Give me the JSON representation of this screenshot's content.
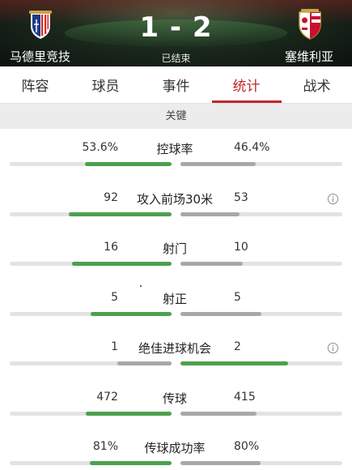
{
  "header": {
    "home_team": "马德里竞技",
    "away_team": "塞维利亚",
    "score": "1 - 2",
    "status": "已结束",
    "home_crest_icon": "atletico-crest-icon",
    "away_crest_icon": "sevilla-crest-icon"
  },
  "tabs": [
    {
      "label": "阵容"
    },
    {
      "label": "球员"
    },
    {
      "label": "事件"
    },
    {
      "label": "统计",
      "active": true
    },
    {
      "label": "战术"
    }
  ],
  "section": {
    "title": "关键"
  },
  "colors": {
    "accent": "#c0262c",
    "bar_win": "#4ca14e",
    "bar_lose": "#a8a8a8",
    "track": "#e3e3e3"
  },
  "stats": [
    {
      "label": "控球率",
      "home": "53.6%",
      "away": "46.4%",
      "home_fraction": 0.536,
      "away_fraction": 0.464,
      "info": false
    },
    {
      "label": "攻入前场30米",
      "home": "92",
      "away": "53",
      "home_fraction": 0.634,
      "away_fraction": 0.366,
      "info": true
    },
    {
      "label": "射门",
      "home": "16",
      "away": "10",
      "home_fraction": 0.615,
      "away_fraction": 0.385,
      "info": false
    },
    {
      "label": "射正",
      "home": "5",
      "away": "5",
      "home_fraction": 0.5,
      "away_fraction": 0.5,
      "info": false
    },
    {
      "label": "绝佳进球机会",
      "home": "1",
      "away": "2",
      "home_fraction": 0.333,
      "away_fraction": 0.667,
      "info": true
    },
    {
      "label": "传球",
      "home": "472",
      "away": "415",
      "home_fraction": 0.532,
      "away_fraction": 0.468,
      "info": false
    },
    {
      "label": "传球成功率",
      "home": "81%",
      "away": "80%",
      "home_fraction": 0.503,
      "away_fraction": 0.497,
      "info": false
    }
  ]
}
